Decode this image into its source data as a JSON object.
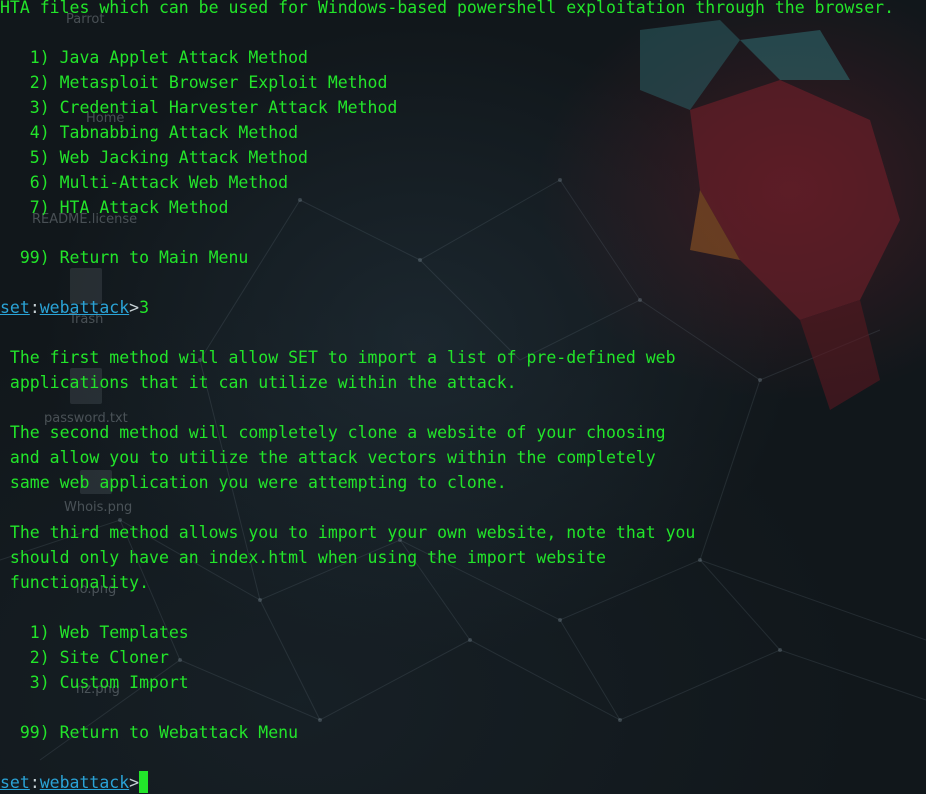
{
  "desktop": {
    "icons": [
      "Parrot",
      "Home",
      "README.license",
      "Trash",
      "password.txt",
      "Whois.png",
      "lo.png",
      "hz.png"
    ]
  },
  "terminal": {
    "lines": {
      "hta_note": "HTA files which can be used for Windows-based powershell exploitation through the browser.",
      "m1": "   1) Java Applet Attack Method",
      "m2": "   2) Metasploit Browser Exploit Method",
      "m3": "   3) Credential Harvester Attack Method",
      "m4": "   4) Tabnabbing Attack Method",
      "m5": "   5) Web Jacking Attack Method",
      "m6": "   6) Multi-Attack Web Method",
      "m7": "   7) HTA Attack Method",
      "m99": "  99) Return to Main Menu",
      "p1": " The first method will allow SET to import a list of pre-defined web",
      "p2": " applications that it can utilize within the attack.",
      "p3": " The second method will completely clone a website of your choosing",
      "p4": " and allow you to utilize the attack vectors within the completely",
      "p5": " same web application you were attempting to clone.",
      "p6": " The third method allows you to import your own website, note that you",
      "p7": " should only have an index.html when using the import website",
      "p8": " functionality.",
      "s1": "   1) Web Templates",
      "s2": "   2) Site Cloner",
      "s3": "   3) Custom Import",
      "s99": "  99) Return to Webattack Menu"
    },
    "prompt": {
      "tool": "set",
      "separator": ":",
      "module": "webattack",
      "symbol": ">"
    },
    "entered_command": "3",
    "colors": {
      "text": "#22e52a",
      "prompt_link": "#2aa3d6",
      "prompt_punct": "#c8d2d6",
      "cursor": "#22e52a"
    }
  }
}
